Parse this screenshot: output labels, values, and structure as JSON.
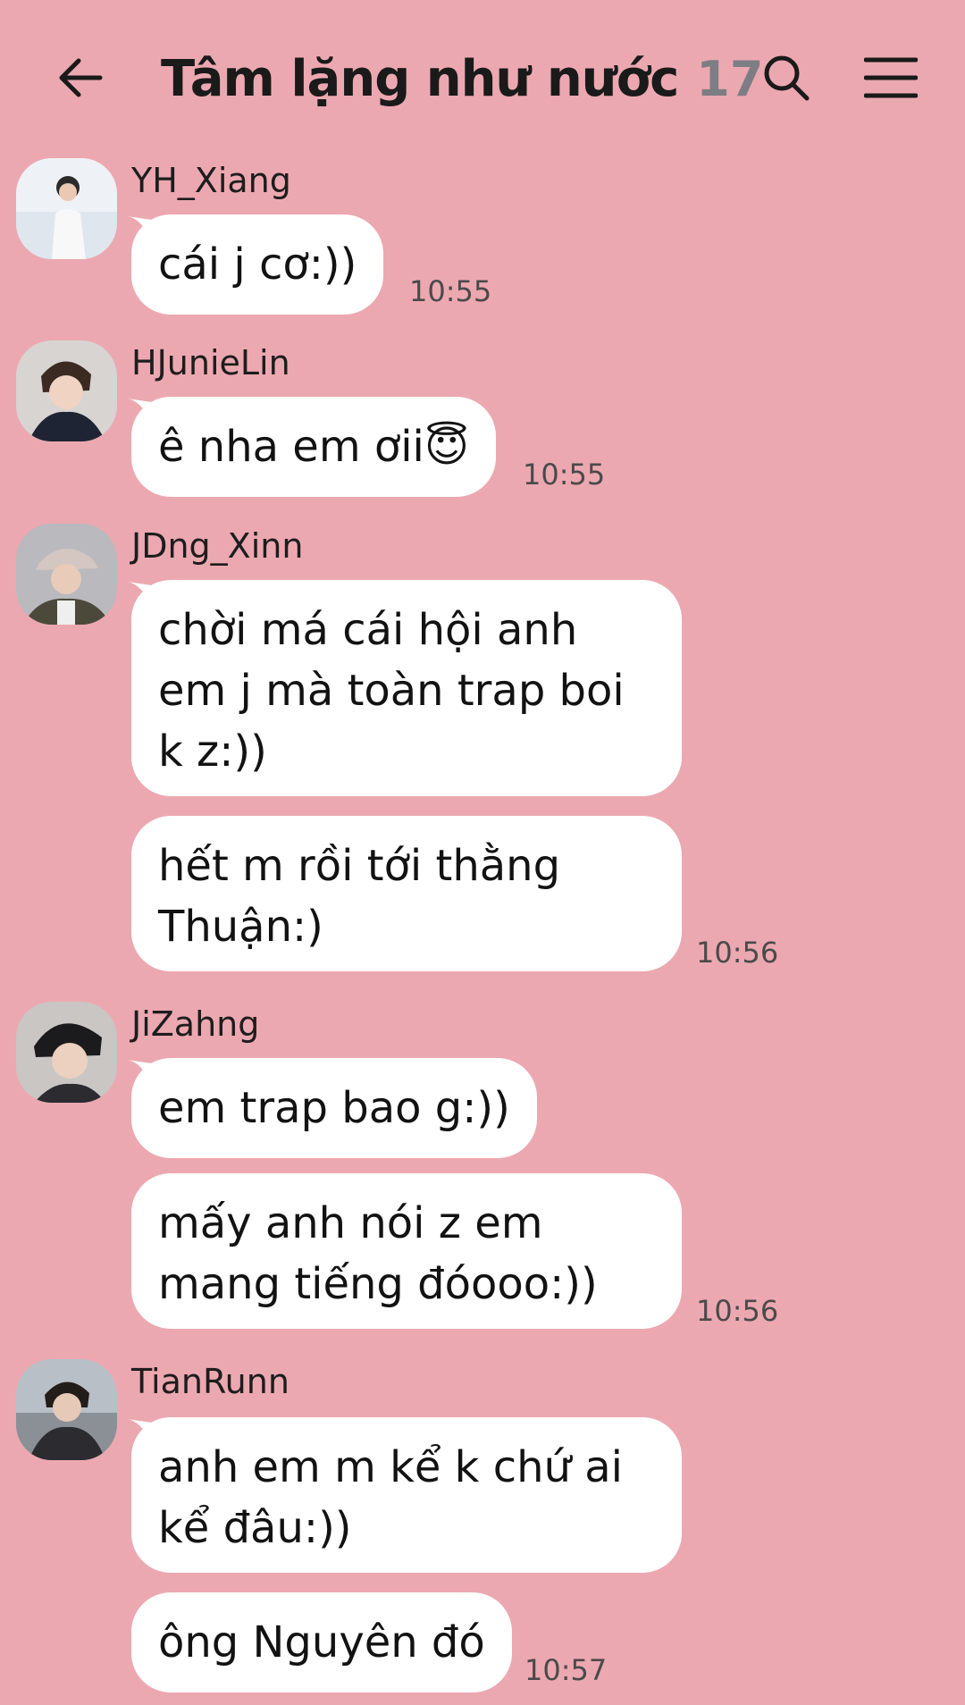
{
  "header": {
    "title": "Tâm lặng như nước",
    "member_count": "17",
    "back_icon": "arrow-left-icon",
    "search_icon": "search-icon",
    "menu_icon": "hamburger-menu-icon"
  },
  "messages": [
    {
      "sender": "YH_Xiang",
      "bubbles": [
        "cái j cơ:))"
      ],
      "time": "10:55"
    },
    {
      "sender": "HJunieLin",
      "bubbles": [
        "ê nha em ơii😇"
      ],
      "time": "10:55"
    },
    {
      "sender": "JDng_Xinn",
      "bubbles": [
        "chời má cái hội anh em j mà toàn trap boi k z:))",
        "hết m rồi tới thằng Thuận:)"
      ],
      "time": "10:56"
    },
    {
      "sender": "JiZahng",
      "bubbles": [
        "em trap bao g:))",
        "mấy anh nói z em mang tiếng đóooo:))"
      ],
      "time": "10:56"
    },
    {
      "sender": "TianRunn",
      "bubbles": [
        "anh em m kể k chứ ai kể đâu:))",
        "ông Nguyên đó"
      ],
      "time": "10:57"
    }
  ],
  "colors": {
    "background": "#eca8b0",
    "bubble": "#ffffff",
    "text": "#121212",
    "member_count": "#7d7d84"
  }
}
